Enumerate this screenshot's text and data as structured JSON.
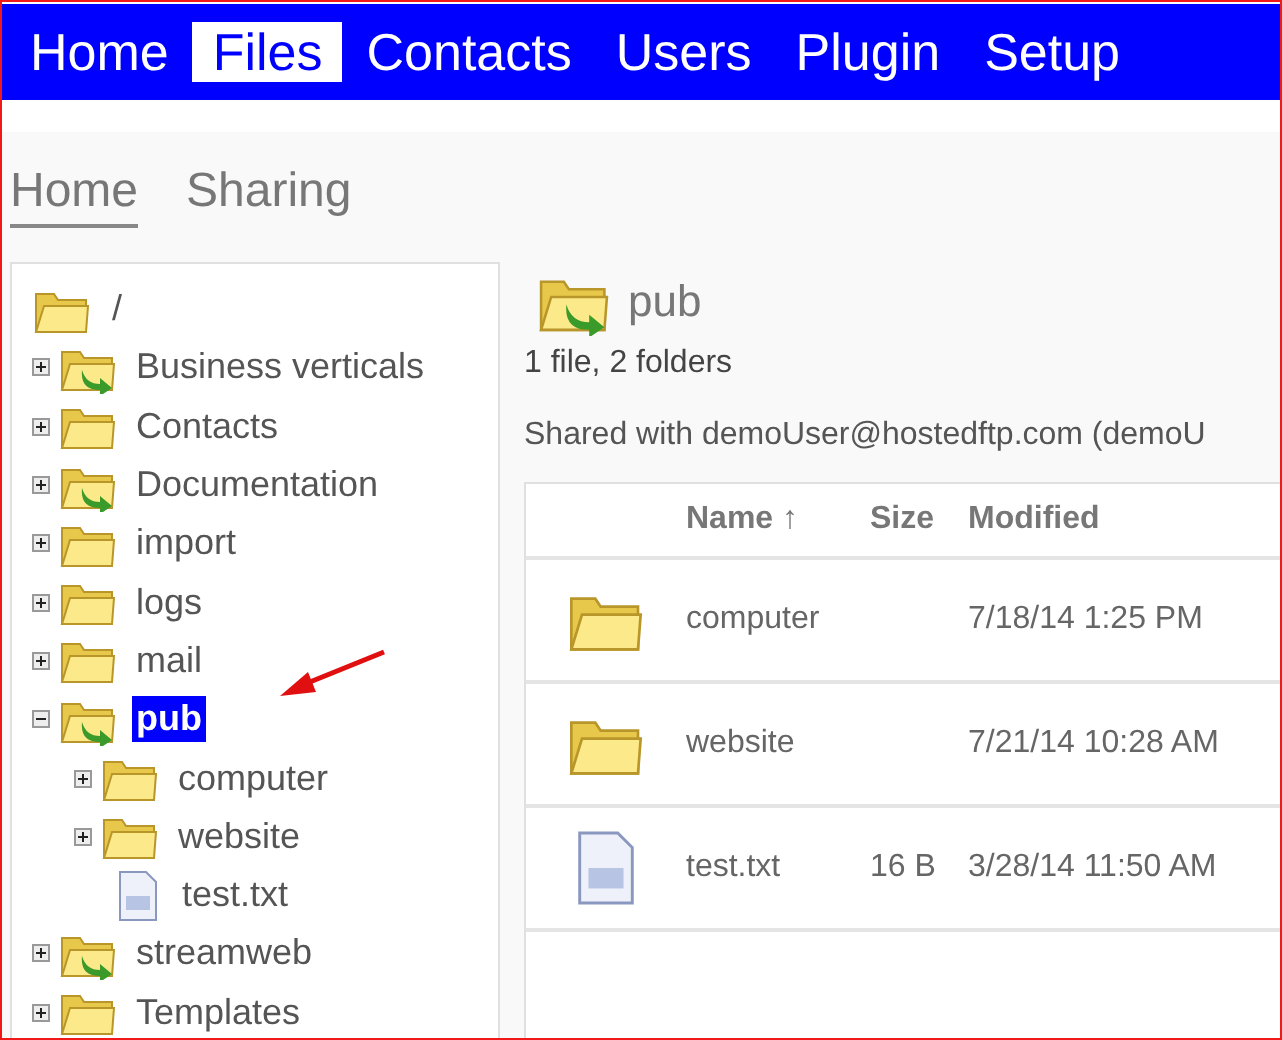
{
  "nav": [
    {
      "label": "Home",
      "selected": false
    },
    {
      "label": "Files",
      "selected": true
    },
    {
      "label": "Contacts",
      "selected": false
    },
    {
      "label": "Users",
      "selected": false
    },
    {
      "label": "Plugin",
      "selected": false
    },
    {
      "label": "Setup",
      "selected": false
    }
  ],
  "subtabs": [
    {
      "label": "Home",
      "selected": true
    },
    {
      "label": "Sharing",
      "selected": false
    }
  ],
  "tree": {
    "root": {
      "label": "/"
    },
    "children": [
      {
        "label": "Business verticals",
        "kind": "shared-folder",
        "expanded": false,
        "selected": false
      },
      {
        "label": "Contacts",
        "kind": "folder",
        "expanded": false,
        "selected": false
      },
      {
        "label": "Documentation",
        "kind": "shared-folder",
        "expanded": false,
        "selected": false
      },
      {
        "label": "import",
        "kind": "folder",
        "expanded": false,
        "selected": false
      },
      {
        "label": "logs",
        "kind": "folder",
        "expanded": false,
        "selected": false
      },
      {
        "label": "mail",
        "kind": "folder",
        "expanded": false,
        "selected": false
      },
      {
        "label": "pub",
        "kind": "shared-folder",
        "expanded": true,
        "selected": true,
        "children": [
          {
            "label": "computer",
            "kind": "folder",
            "expanded": false,
            "selected": false
          },
          {
            "label": "website",
            "kind": "folder",
            "expanded": false,
            "selected": false
          },
          {
            "label": "test.txt",
            "kind": "file",
            "selected": false
          }
        ]
      },
      {
        "label": "streamweb",
        "kind": "shared-folder",
        "expanded": false,
        "selected": false
      },
      {
        "label": "Templates",
        "kind": "folder",
        "expanded": false,
        "selected": false
      }
    ]
  },
  "folder": {
    "title": "pub",
    "kind": "shared-folder",
    "summary": "1 file, 2 folders",
    "shared": "Shared with demoUser@hostedftp.com (demoU"
  },
  "table": {
    "columns": [
      "Name ↑",
      "Size",
      "Modified"
    ],
    "rows": [
      {
        "kind": "folder",
        "name": "computer",
        "size": "",
        "modified": "7/18/14 1:25 PM"
      },
      {
        "kind": "folder",
        "name": "website",
        "size": "",
        "modified": "7/21/14 10:28 AM"
      },
      {
        "kind": "file",
        "name": "test.txt",
        "size": "16 B",
        "modified": "3/28/14 11:50 AM"
      }
    ]
  }
}
